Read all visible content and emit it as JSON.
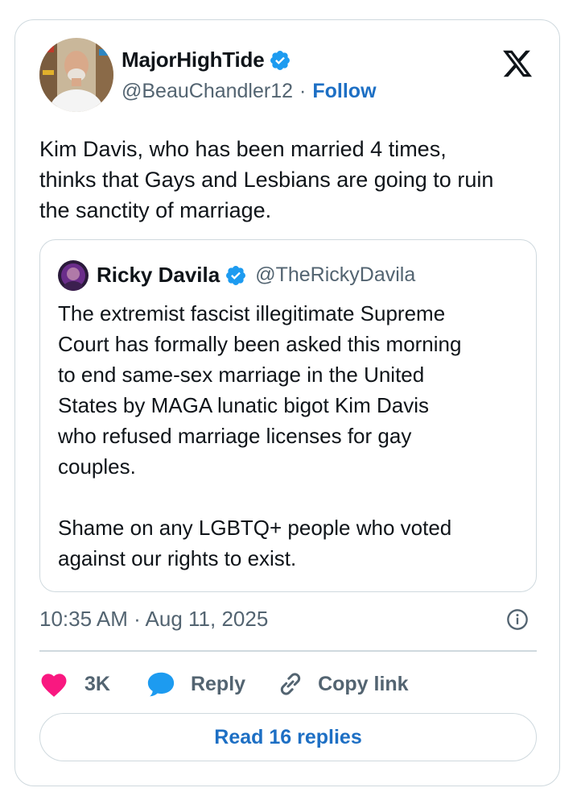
{
  "author": {
    "display_name": "MajorHighTide",
    "handle": "@BeauChandler12",
    "separator": "·",
    "follow_label": "Follow"
  },
  "tweet": {
    "text": "Kim Davis, who has been married 4 times,\nthinks that Gays and Lesbians are going to ruin\nthe sanctity of marriage."
  },
  "quoted_tweet": {
    "display_name": "Ricky Davila",
    "handle": "@TheRickyDavila",
    "text": "The extremist fascist illegitimate Supreme\nCourt has formally been asked this morning\nto end same-sex marriage in the United\nStates by MAGA lunatic bigot Kim Davis\nwho refused marriage licenses for gay\ncouples.\n\nShame on any LGBTQ+ people who voted\nagainst our rights to exist."
  },
  "meta": {
    "timestamp": "10:35 AM · Aug 11, 2025"
  },
  "actions": {
    "like_count": "3K",
    "reply_label": "Reply",
    "copy_label": "Copy link",
    "read_replies_label": "Read 16 replies"
  },
  "icons": {
    "verified": "verified-badge-icon",
    "brand": "x-logo-icon",
    "info": "info-icon",
    "like": "heart-icon",
    "reply": "speech-bubble-icon",
    "copy": "link-icon"
  },
  "colors": {
    "text_primary": "#0f1419",
    "text_secondary": "#536471",
    "link": "#1d6fc4",
    "verified": "#1d9bf0",
    "heart": "#f91880",
    "reply_bubble": "#1d9bf0",
    "border": "#cfd9de"
  }
}
